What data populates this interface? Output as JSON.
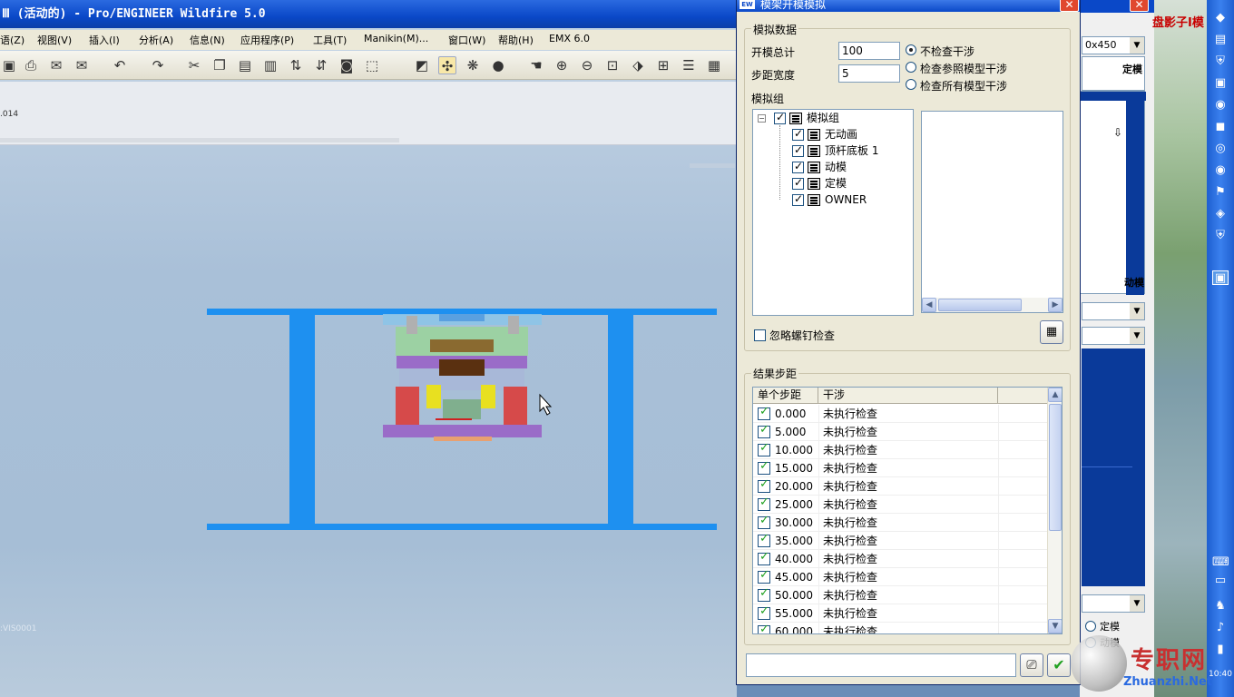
{
  "app": {
    "title": "Ⅲ (活动的) - Pro/ENGINEER Wildfire 5.0",
    "menu": [
      "语(Z)",
      "视图(V)",
      "插入(I)",
      "分析(A)",
      "信息(N)",
      "应用程序(P)",
      "工具(T)",
      "Manikin(M)...",
      "窗口(W)",
      "帮助(H)",
      "EMX 6.0"
    ],
    "info_label": ".014",
    "status_label": ":VIS0001"
  },
  "dialog": {
    "title": "模架开模模拟",
    "app_icon": "EW",
    "close_icon": "✕",
    "sim_data_group": "模拟数据",
    "open_total_label": "开模总计",
    "open_total_value": "100",
    "step_width_label": "步距宽度",
    "step_width_value": "5",
    "radio_options": [
      "不检查干涉",
      "检查参照模型干涉",
      "检查所有模型干涉"
    ],
    "radio_selected": 0,
    "sim_group_label": "模拟组",
    "tree_root": "模拟组",
    "tree_children": [
      "无动画",
      "顶杆底板 1",
      "动模",
      "定模",
      "OWNER"
    ],
    "ignore_screw_label": "忽略螺钉检查",
    "result_group": "结果步距",
    "table_headers": [
      "单个步距",
      "干涉"
    ],
    "results": [
      {
        "step": "0.000",
        "status": "未执行检查"
      },
      {
        "step": "5.000",
        "status": "未执行检查"
      },
      {
        "step": "10.000",
        "status": "未执行检查"
      },
      {
        "step": "15.000",
        "status": "未执行检查"
      },
      {
        "step": "20.000",
        "status": "未执行检查"
      },
      {
        "step": "25.000",
        "status": "未执行检查"
      },
      {
        "step": "30.000",
        "status": "未执行检查"
      },
      {
        "step": "35.000",
        "status": "未执行检查"
      },
      {
        "step": "40.000",
        "status": "未执行检查"
      },
      {
        "step": "45.000",
        "status": "未执行检查"
      },
      {
        "step": "50.000",
        "status": "未执行检查"
      },
      {
        "step": "55.000",
        "status": "未执行检查"
      },
      {
        "step": "60.000",
        "status": "未执行检查"
      }
    ],
    "ok_icon": "✔"
  },
  "background_window": {
    "close_icon": "✕",
    "combo_value": "0x450",
    "label_fixed": "定模",
    "label_moving": "动模",
    "radio_fixed": "定模",
    "radio_moving": "动模"
  },
  "desktop": {
    "title_fragment": "盘影子I模",
    "watermark_text": "专职网",
    "watermark_url": "Zhuanzhi.Net",
    "clock": "10:40"
  },
  "colors": {
    "mold_plate_blue": "#1e90f0",
    "mold_purple": "#9a6cc8",
    "mold_red": "#d64a4a",
    "titlebar_blue": "#0a48c8",
    "check_green": "#21a121"
  }
}
